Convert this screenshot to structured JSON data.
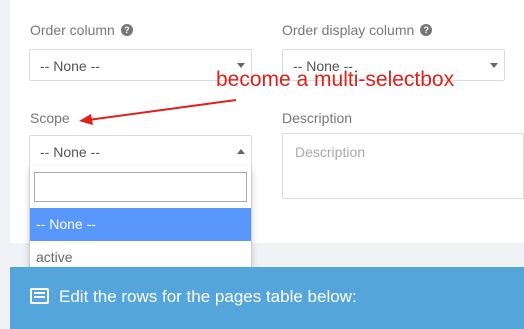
{
  "form": {
    "order_column": {
      "label": "Order column",
      "value": "-- None --"
    },
    "order_display_column": {
      "label": "Order display column",
      "value": "-- None --"
    },
    "scope": {
      "label": "Scope",
      "value": "-- None --",
      "search_value": "",
      "options": [
        "-- None --",
        "active"
      ],
      "selected_option": "-- None --"
    },
    "description": {
      "label": "Description",
      "placeholder": "Description"
    }
  },
  "annotation": {
    "text": "become a multi-selectbox",
    "color": "#e0201b"
  },
  "banner": {
    "text": "Edit the rows for the pages table below:",
    "color": "#55a5dd"
  },
  "colors": {
    "highlight": "#5897fb"
  }
}
